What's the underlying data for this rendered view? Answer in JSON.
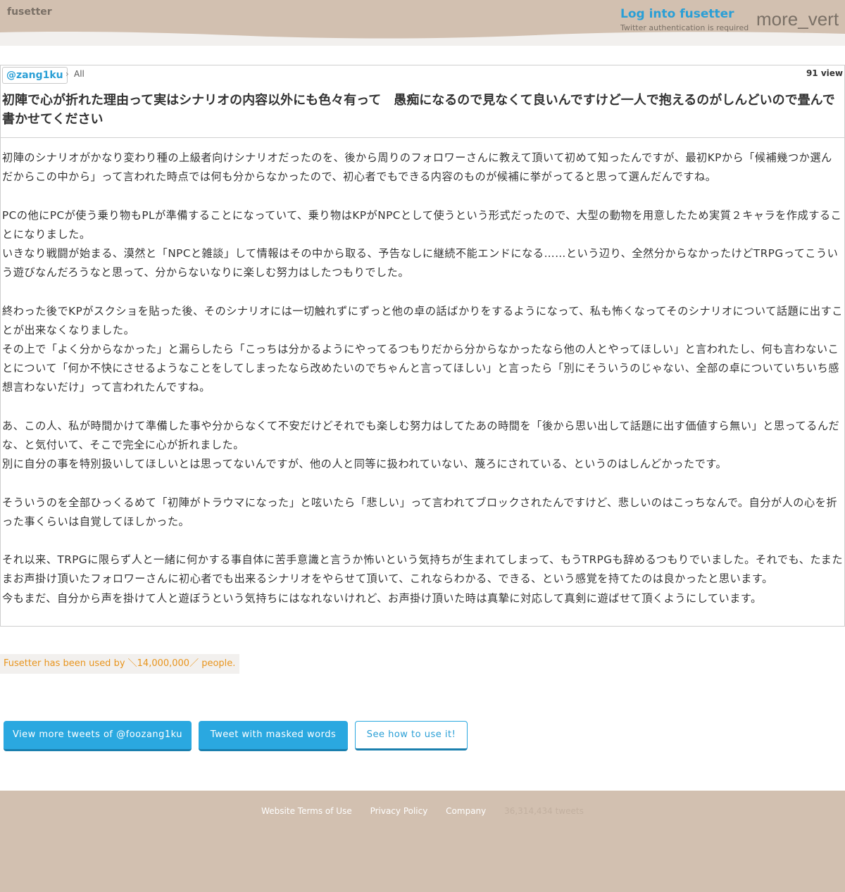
{
  "header": {
    "site_name": "fusetter",
    "login_label": "Log into fusetter",
    "login_sub": "Twitter authentication is required",
    "more_icon": "more_vert",
    "colors": {
      "wave": "#d2c0b0",
      "link": "#2a9fd6"
    }
  },
  "post": {
    "user": "@zang1ku",
    "crumb_sep": "›",
    "crumb": "All",
    "views": "91 view",
    "title": "初陣で心が折れた理由って実はシナリオの内容以外にも色々有って　愚痴になるので見なくて良いんですけど一人で抱えるのがしんどいので畳んで書かせてください",
    "paragraphs": [
      "初陣のシナリオがかなり変わり種の上級者向けシナリオだったのを、後から周りのフォロワーさんに教えて頂いて初めて知ったんですが、最初KPから「候補幾つか選んだからこの中から」って言われた時点では何も分からなかったので、初心者でもできる内容のものが候補に挙がってると思って選んだんですね。",
      "",
      "PCの他にPCが使う乗り物もPLが準備することになっていて、乗り物はKPがNPCとして使うという形式だったので、大型の動物を用意したため実質２キャラを作成することになりました。",
      "いきなり戦闘が始まる、漠然と「NPCと雑談」して情報はその中から取る、予告なしに継続不能エンドになる……という辺り、全然分からなかったけどTRPGってこういう遊びなんだろうなと思って、分からないなりに楽しむ努力はしたつもりでした。",
      "",
      "終わった後でKPがスクショを貼った後、そのシナリオには一切触れずにずっと他の卓の話ばかりをするようになって、私も怖くなってそのシナリオについて話題に出すことが出来なくなりました。",
      "その上で「よく分からなかった」と漏らしたら「こっちは分かるようにやってるつもりだから分からなかったなら他の人とやってほしい」と言われたし、何も言わないことについて「何か不快にさせるようなことをしてしまったなら改めたいのでちゃんと言ってほしい」と言ったら「別にそういうのじゃない、全部の卓についていちいち感想言わないだけ」って言われたんですね。",
      "",
      "あ、この人、私が時間かけて準備した事や分からなくて不安だけどそれでも楽しむ努力はしてたあの時間を「後から思い出して話題に出す価値すら無い」と思ってるんだな、と気付いて、そこで完全に心が折れました。",
      "別に自分の事を特別扱いしてほしいとは思ってないんですが、他の人と同等に扱われていない、蔑ろにされている、というのはしんどかったです。",
      "",
      "そういうのを全部ひっくるめて「初陣がトラウマになった」と呟いたら「悲しい」って言われてブロックされたんですけど、悲しいのはこっちなんで。自分が人の心を折った事くらいは自覚してほしかった。",
      "",
      "それ以来、TRPGに限らず人と一緒に何かする事自体に苦手意識と言うか怖いという気持ちが生まれてしまって、もうTRPGも辞めるつもりでいました。それでも、たまたまお声掛け頂いたフォロワーさんに初心者でも出来るシナリオをやらせて頂いて、これならわかる、できる、という感覚を持てたのは良かったと思います。",
      "今もまだ、自分から声を掛けて人と遊ぼうという気持ちにはなれないけれど、お声掛け頂いた時は真摯に対応して真剣に遊ばせて頂くようにしています。"
    ]
  },
  "counter": "Fusetter has been used by ＼14,000,000／ people.",
  "buttons": {
    "view_more": "View more tweets of @foozang1ku",
    "masked": "Tweet with masked words",
    "how_to": "See how to use it!"
  },
  "footer": {
    "terms": "Website Terms of Use",
    "privacy": "Privacy Policy",
    "company": "Company",
    "tweet_count": "36,314,434 tweets"
  }
}
